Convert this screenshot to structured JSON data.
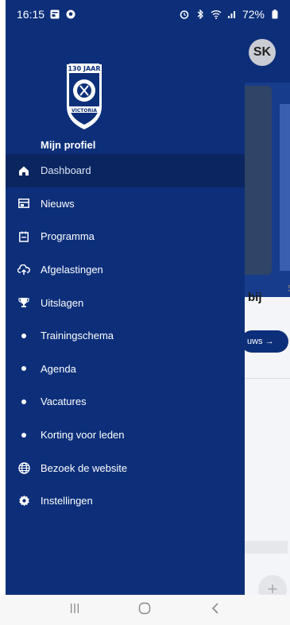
{
  "status_bar": {
    "time": "16:15",
    "battery": "72%",
    "icons_left": [
      "gallery-icon",
      "soccer-ball-icon"
    ],
    "icons_right": [
      "alarm-icon",
      "bluetooth-icon",
      "wifi-icon",
      "signal-icon",
      "battery-icon"
    ]
  },
  "background": {
    "avatar_initials": "SK",
    "partial_text": "bij",
    "partial_text2": "S",
    "pill_text": "uws →",
    "fab_icon": "plus-icon"
  },
  "drawer": {
    "logo_text": [
      "130 JAAR",
      "VICTORIA"
    ],
    "profile_label": "Mijn profiel",
    "items": [
      {
        "label": "Dashboard",
        "icon": "home-icon",
        "active": true
      },
      {
        "label": "Nieuws",
        "icon": "news-icon"
      },
      {
        "label": "Programma",
        "icon": "calendar-icon"
      },
      {
        "label": "Afgelastingen",
        "icon": "cloud-icon"
      },
      {
        "label": "Uitslagen",
        "icon": "trophy-icon"
      },
      {
        "label": "Trainingschema",
        "icon": "dot-icon"
      },
      {
        "label": "Agenda",
        "icon": "dot-icon"
      },
      {
        "label": "Vacatures",
        "icon": "dot-icon"
      },
      {
        "label": "Korting voor leden",
        "icon": "dot-icon"
      },
      {
        "label": "Bezoek de website",
        "icon": "globe-icon"
      },
      {
        "label": "Instellingen",
        "icon": "gear-icon"
      }
    ]
  },
  "colors": {
    "drawer": "#0d2f7a",
    "active_item": "#0b2560"
  }
}
